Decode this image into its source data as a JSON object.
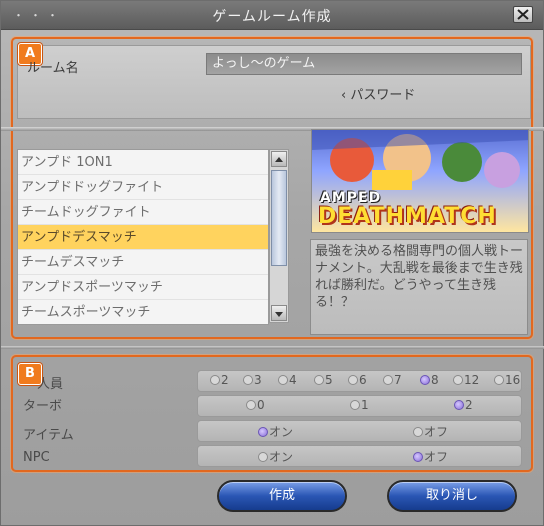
{
  "window": {
    "title": "ゲームルーム作成",
    "title_dots": "・・・"
  },
  "section_a": {
    "badge": "A"
  },
  "section_b": {
    "badge": "B"
  },
  "room": {
    "name_label": "ルーム名",
    "name_value": "よっし～のゲーム",
    "password_label": "パスワード"
  },
  "modes": {
    "items": [
      "アンプド 1ON1",
      "アンプドドッグファイト",
      "チームドッグファイト",
      "アンプドデスマッチ",
      "チームデスマッチ",
      "アンプドスポーツマッチ",
      "チームスポーツマッチ"
    ],
    "selected_index": 3
  },
  "preview": {
    "logo_line1": "AMPED",
    "logo_line2": "DEATHMATCH",
    "description": "最強を決める格闘専門の個人戦トーナメント。大乱戦を最後まで生き残れば勝利だ。どうやって生き残る！？"
  },
  "settings": {
    "members": {
      "label": "人員",
      "options": [
        "2",
        "3",
        "4",
        "5",
        "6",
        "7",
        "8",
        "12",
        "16"
      ],
      "selected": "8"
    },
    "turbo": {
      "label": "ターボ",
      "options": [
        "0",
        "1",
        "2"
      ],
      "selected": "2"
    },
    "items": {
      "label": "アイテム",
      "options": [
        "オン",
        "オフ"
      ],
      "selected": "オン"
    },
    "npc": {
      "label": "NPC",
      "options": [
        "オン",
        "オフ"
      ],
      "selected": "オフ"
    }
  },
  "buttons": {
    "create": "作成",
    "cancel": "取り消し"
  },
  "colors": {
    "accent": "#e2681f",
    "selected_row": "#ffd35e",
    "button": "#2a56b4"
  }
}
